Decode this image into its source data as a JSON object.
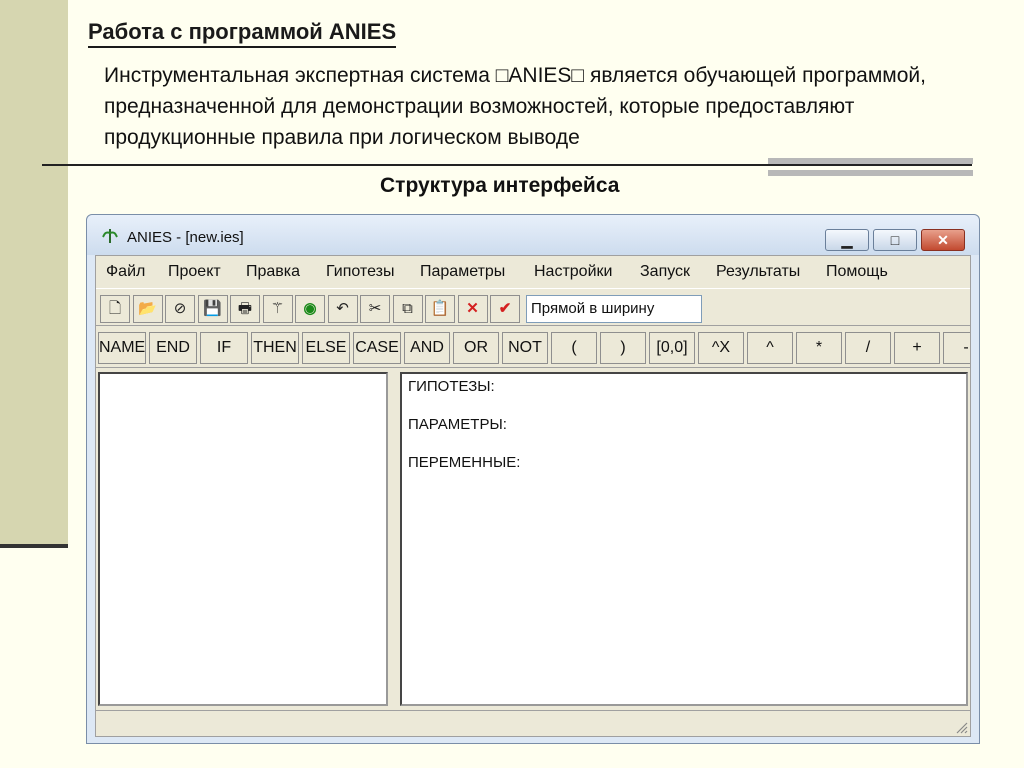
{
  "slide": {
    "title": "Работа с программой ANIES",
    "text": "Инструментальная экспертная система □ANIES□ является обучающей программой, предназначенной для демонстрации возможностей, которые предоставляют продукционные правила при логическом выводе",
    "subtitle": "Структура интерфейса"
  },
  "window": {
    "title": "ANIES - [new.ies]",
    "buttons": {
      "minimize": "▁",
      "maximize": "□",
      "close": "✕"
    }
  },
  "menu": [
    "Файл",
    "Проект",
    "Правка",
    "Гипотезы",
    "Параметры",
    "Настройки",
    "Запуск",
    "Результаты",
    "Помощь"
  ],
  "toolbar": {
    "icons": [
      {
        "name": "new-file-icon",
        "glyph": "🗋"
      },
      {
        "name": "open-folder-icon",
        "glyph": "📂"
      },
      {
        "name": "close-file-icon",
        "glyph": "⊘"
      },
      {
        "name": "save-icon",
        "glyph": "💾"
      },
      {
        "name": "print-icon",
        "glyph": "🖶"
      },
      {
        "name": "wand-icon",
        "glyph": "⚚"
      },
      {
        "name": "run-icon",
        "glyph": "◉"
      },
      {
        "name": "undo-icon",
        "glyph": "↶"
      },
      {
        "name": "cut-icon",
        "glyph": "✂"
      },
      {
        "name": "copy-icon",
        "glyph": "⧉"
      },
      {
        "name": "paste-icon",
        "glyph": "📋"
      },
      {
        "name": "delete-icon",
        "glyph": "✕"
      },
      {
        "name": "check-icon",
        "glyph": "✔"
      }
    ],
    "combo_value": "Прямой в ширину",
    "colors": {
      "delete": "#d42020",
      "check": "#d42020",
      "run": "#1a8a1a"
    }
  },
  "keywords": [
    "NAME",
    "END",
    "IF",
    "THEN",
    "ELSE",
    "CASE",
    "AND",
    "OR",
    "NOT",
    "(",
    ")",
    "[0,0]",
    "^X",
    "^",
    "*",
    "/",
    "+",
    "-"
  ],
  "editor": {
    "lines": [
      "ГИПОТЕЗЫ:",
      "ПАРАМЕТРЫ:",
      "ПЕРЕМЕННЫЕ:"
    ]
  }
}
